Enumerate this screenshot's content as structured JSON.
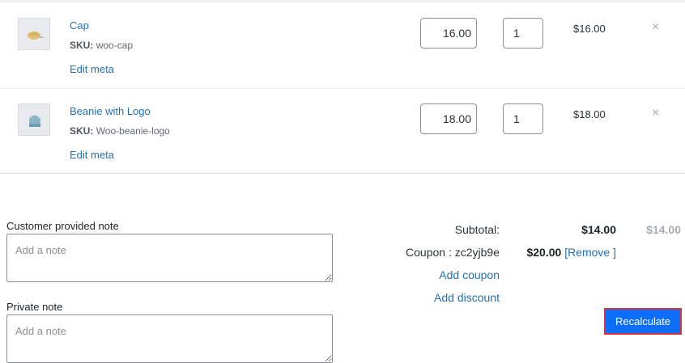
{
  "items": [
    {
      "name": "Cap",
      "sku_label": "SKU:",
      "sku": "woo-cap",
      "edit_meta": "Edit meta",
      "price": "16.00",
      "qty": "1",
      "total": "$16.00",
      "remove": "×"
    },
    {
      "name": "Beanie with Logo",
      "sku_label": "SKU:",
      "sku": "Woo-beanie-logo",
      "edit_meta": "Edit meta",
      "price": "18.00",
      "qty": "1",
      "total": "$18.00",
      "remove": "×"
    }
  ],
  "notes": {
    "customer_label": "Customer provided note",
    "customer_placeholder": "Add a note",
    "private_label": "Private note",
    "private_placeholder": "Add a note"
  },
  "totals": {
    "subtotal_label": "Subtotal:",
    "subtotal_value": "$14.00",
    "subtotal_muted": "$14.00",
    "coupon_label": "Coupon : zc2yjb9e",
    "coupon_value": "$20.00",
    "coupon_remove": "[Remove ]",
    "add_coupon": "Add coupon",
    "add_discount": "Add discount"
  },
  "actions": {
    "recalculate": "Recalculate"
  },
  "colors": {
    "link": "#2271b1",
    "button": "#0d6efd",
    "highlight_border": "#d63638"
  }
}
